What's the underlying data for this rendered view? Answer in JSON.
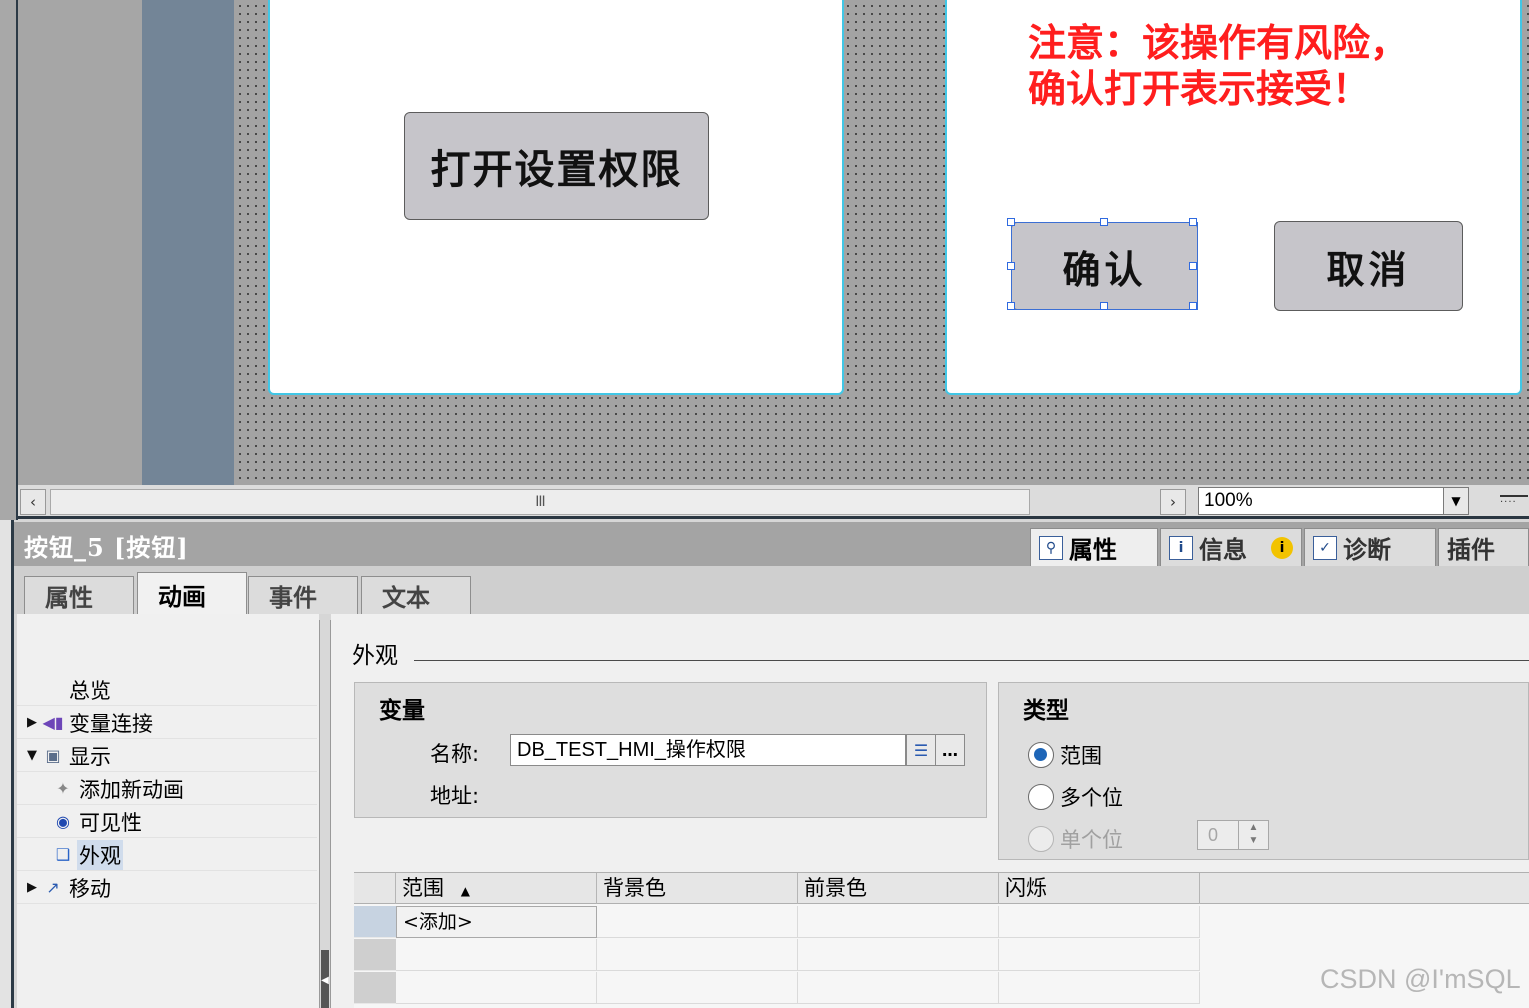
{
  "canvas": {
    "open_button": "打开设置权限",
    "warning_line1": "注意：该操作有风险，",
    "warning_line2": "确认打开表示接受！",
    "confirm_button": "确认",
    "cancel_button": "取消"
  },
  "view_bar": {
    "zoom": "100%",
    "scroll_thumb": "III"
  },
  "inspector": {
    "title": "按钮_5 [按钮]",
    "right_tabs": [
      "属性",
      "信息",
      "诊断",
      "插件"
    ],
    "sub_tabs": [
      "属性",
      "动画",
      "事件",
      "文本"
    ],
    "active_sub_tab": "动画",
    "tree": {
      "overview": "总览",
      "tag_connection": "变量连接",
      "display": "显示",
      "add_animation": "添加新动画",
      "visibility": "可见性",
      "appearance": "外观",
      "movement": "移动"
    },
    "section_title": "外观",
    "variable_group": {
      "title": "变量",
      "name_label": "名称:",
      "name_value": "DB_TEST_HMI_操作权限",
      "address_label": "地址:"
    },
    "type_group": {
      "title": "类型",
      "options": [
        "范围",
        "多个位",
        "单个位"
      ],
      "selected": "范围",
      "bit_value": "0"
    },
    "table": {
      "columns": [
        "范围",
        "背景色",
        "前景色",
        "闪烁"
      ],
      "add_row": "<添加>"
    }
  },
  "watermark": "CSDN @I'mSQL",
  "colors": {
    "warning": "#ff1e1e",
    "panel_border": "#41c7e6",
    "selection": "#2f6ae0",
    "radio_on": "#1e66b8"
  }
}
